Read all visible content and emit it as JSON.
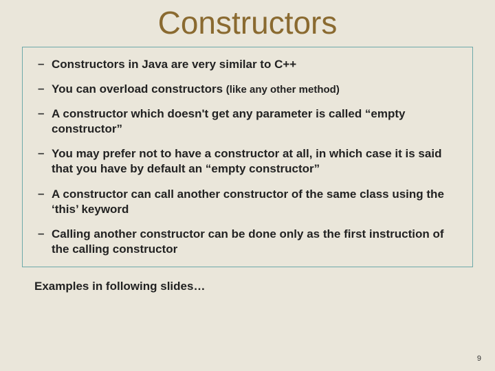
{
  "title": "Constructors",
  "bullets": [
    {
      "text": "Constructors in Java are very similar to C++"
    },
    {
      "text": "You can overload constructors ",
      "suffix_small": "(like any other method)"
    },
    {
      "text": "A constructor which doesn't get any parameter is called “empty constructor”"
    },
    {
      "text": "You may prefer not to have a constructor at all, in which case it is said that you have by default an “empty constructor”"
    },
    {
      "text": "A constructor can call another constructor of the same class using the ‘this’ keyword"
    },
    {
      "text": "Calling another constructor can be done only as the first instruction of the calling constructor"
    }
  ],
  "footer_note": "Examples in following slides…",
  "page_number": "9"
}
